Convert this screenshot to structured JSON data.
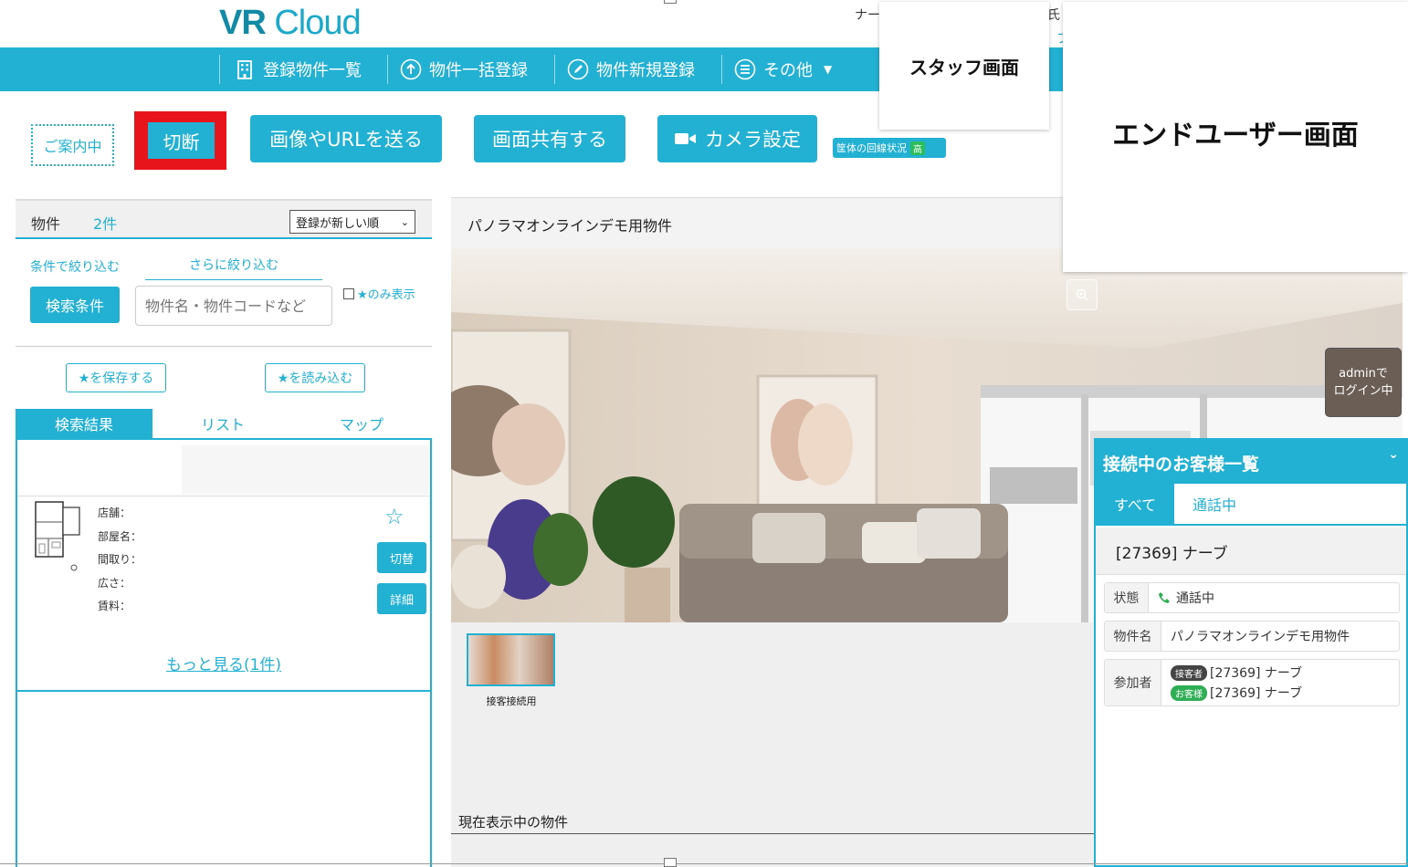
{
  "header": {
    "logo_vr": "VR",
    "logo_cloud": "Cloud",
    "user_text_1": "ナー",
    "user_text_2": "氏",
    "user_text_3": "フ"
  },
  "nav": {
    "items": [
      {
        "label": "登録物件一覧",
        "icon": "building-icon"
      },
      {
        "label": "物件一括登録",
        "icon": "upload-icon"
      },
      {
        "label": "物件新規登録",
        "icon": "pencil-icon"
      },
      {
        "label": "その他",
        "icon": "menu-icon"
      }
    ]
  },
  "actions": {
    "annai": "ご案内中",
    "cut": "切断",
    "send_image": "画像やURLを送る",
    "share_screen": "画面共有する",
    "camera": "カメラ設定",
    "line_status": "筐体の回線状況",
    "line_level": "高"
  },
  "overlays": {
    "staff": "スタッフ画面",
    "enduser": "エンドユーザー画面"
  },
  "left": {
    "title": "物件",
    "count": "2件",
    "sort": "登録が新しい順",
    "filter_tab1": "条件で絞り込む",
    "filter_tab2": "さらに絞り込む",
    "search_button": "検索条件",
    "search_placeholder": "物件名・物件コードなど",
    "star_only": "★のみ表示",
    "save_star": "★を保存する",
    "load_star": "★を読み込む",
    "tabs": [
      "検索結果",
      "リスト",
      "マップ"
    ],
    "card": {
      "fields": [
        "店舗：",
        "部屋名：",
        "間取り：",
        "広さ：",
        "賃料："
      ],
      "switch": "切替",
      "detail": "詳細",
      "star": "☆"
    },
    "more": "もっと見る(1件)"
  },
  "center": {
    "title": "パノラマオンラインデモ用物件",
    "thumb_label": "接客接続用",
    "current": "現在表示中の物件"
  },
  "admin_badge": {
    "line1": "adminで",
    "line2": "ログイン中"
  },
  "customers": {
    "title": "接続中のお客様一覧",
    "tabs": [
      "すべて",
      "通話中"
    ],
    "customer": "[27369] ナーブ",
    "status_key": "状態",
    "status_val": "通話中",
    "property_key": "物件名",
    "property_val": "パノラマオンラインデモ用物件",
    "participants_key": "参加者",
    "participants": [
      {
        "role": "接客者",
        "name": "[27369] ナーブ"
      },
      {
        "role": "お客様",
        "name": "[27369] ナーブ"
      }
    ]
  },
  "colors": {
    "accent": "#22b0d3",
    "highlight": "#e8141c"
  }
}
